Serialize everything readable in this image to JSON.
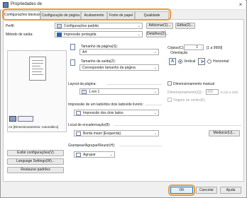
{
  "window": {
    "title": "Propriedades de",
    "close": "×"
  },
  "tabs": [
    "Configurações básicas",
    "Configuração de página",
    "Acabamento",
    "Fonte de papel",
    "Qualidade"
  ],
  "profile": {
    "label": "Perfil:",
    "value": "Configurações padrão",
    "add": "Adicionar(1)...",
    "edit": "Editar(2)..."
  },
  "output": {
    "label": "Método de saída:",
    "value": "Impressão protegida",
    "details": "Detalhes(2)..."
  },
  "preview": {
    "caption": "A4 [Dimensionamento: Automático]"
  },
  "left_buttons": {
    "show_settings": "Exibir configurações(V)",
    "language": "Language Settings(W)...",
    "restore": "Restaurar padrões"
  },
  "page_size": {
    "label": "Tamanho da página(S):",
    "value": "A4"
  },
  "output_size": {
    "label": "Tamanho da saída(Z):",
    "value": "Corresponder tamanho da página"
  },
  "copies": {
    "label": "Cópias(C):",
    "value": "1",
    "range": "[1 a 9999]"
  },
  "orientation": {
    "label": "Orientação",
    "vertical": "Vertical",
    "horizontal": "Horizontal",
    "vertical_glyph": "A",
    "horizontal_glyph": "A"
  },
  "page_layout": {
    "label": "Layout da página:",
    "value": "1 em 1",
    "manual_scaling": "Dimensionamento manual",
    "scaling_label": "Dimensionamento(Q):",
    "scaling_value": "100",
    "scaling_range": "% [25 a 200]",
    "center_origin": "Origem no centro(5)"
  },
  "duplex": {
    "label": "Impressão de um lado/dos dois lados/de livreto:",
    "value": "Impressão dos dois lados"
  },
  "binding": {
    "label": "Local de encadernação(8):",
    "value": "Borda maior [Esquerda]",
    "margin": "Medianiz(U)..."
  },
  "staple": {
    "label": "Grampear/Agrupar/Reunir(H):",
    "value": "Agrupar"
  },
  "footer": {
    "ok": "OK",
    "cancel": "Cancelar",
    "help": "Ajuda"
  }
}
